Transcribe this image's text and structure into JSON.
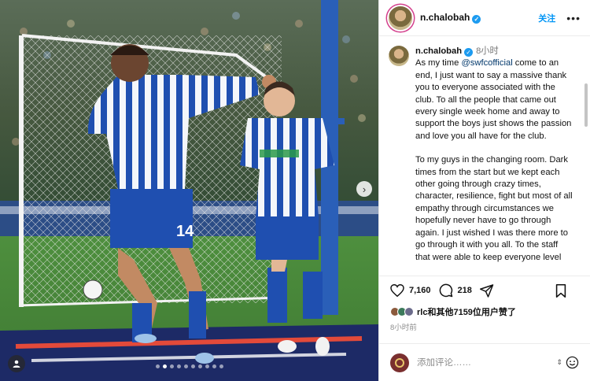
{
  "post": {
    "author": "n.chalobah",
    "follow_label": "关注",
    "more_label": "•••",
    "carousel": {
      "current_index": 2,
      "total": 10
    }
  },
  "caption": {
    "author": "n.chalobah",
    "time_ago": "8小时",
    "intro": "As my time ",
    "mention": "@swfcofficial",
    "paragraph1_rest": " come to an end, I just want to say a massive thank you to everyone associated with the club. To all the people that came out every single week home and away to support the boys just shows the passion and love you all have for the club.",
    "paragraph2": "To my guys in the changing room. Dark times from the start but we kept each other going through crazy times, character, resilience, fight but most of all empathy through circumstances we hopefully never have to go through again. I just wished I was there more to go through it with you all. To the staff that were able to keep everyone level"
  },
  "actions": {
    "like_count": "7,160",
    "comment_count": "218"
  },
  "likes_summary": {
    "text": "rlc和其他7159位用户赞了"
  },
  "posted_ago": "8小时前",
  "comment_box": {
    "placeholder": "添加评论……"
  },
  "icons": {
    "next": "chevron-right-icon",
    "tag": "user-tag-icon",
    "verified": "verified-badge-icon",
    "like": "heart-icon",
    "comment": "comment-icon",
    "share": "send-icon",
    "save": "bookmark-icon",
    "emoji": "emoji-icon"
  },
  "colors": {
    "link": "#0095f6",
    "mention": "#00376b",
    "verified": "#1d9bf0",
    "story_ring": "#d4408d"
  }
}
